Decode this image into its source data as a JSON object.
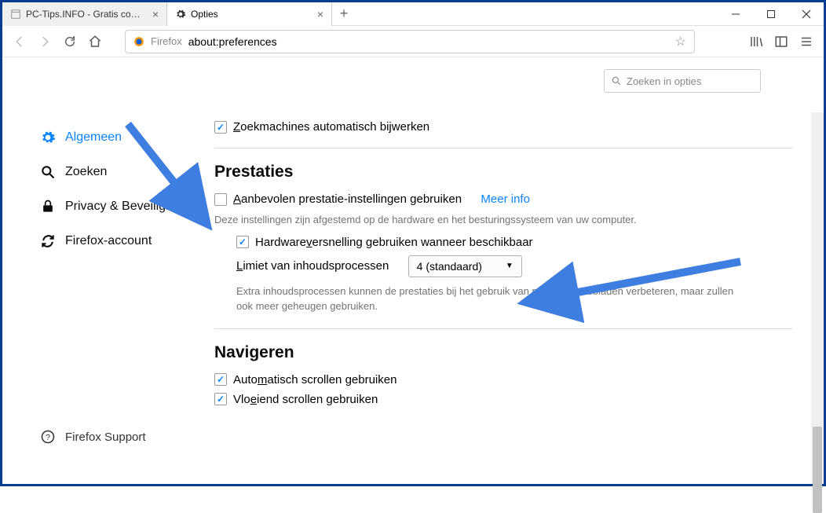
{
  "tabs": {
    "inactive": "PC-Tips.INFO - Gratis computer tips",
    "active": "Opties"
  },
  "urlbar": {
    "label": "Firefox",
    "url": "about:preferences"
  },
  "search": {
    "placeholder": "Zoeken in opties"
  },
  "sidebar": {
    "general": "Algemeen",
    "search": "Zoeken",
    "privacy": "Privacy & Beveiliging",
    "account": "Firefox-account",
    "support": "Firefox Support"
  },
  "updates": {
    "auto_search": "oekmachines automatisch bijwerken"
  },
  "perf": {
    "title": "Prestaties",
    "use_recommended": "anbevolen prestatie-instellingen gebruiken",
    "more_info": "Meer info",
    "desc1": "Deze instellingen zijn afgestemd op de hardware en het besturingssysteem van uw computer.",
    "hw_accel": "ersnelling gebruiken wanneer beschikbaar",
    "hw_accel_pre": "Hardware",
    "limit_pre": "L",
    "limit_label": "imiet van inhoudsprocessen",
    "limit_value": "4 (standaard)",
    "desc2": "Extra inhoudsprocessen kunnen de prestaties bij het gebruik van meerdere tabbladen verbeteren, maar zullen ook meer geheugen gebruiken."
  },
  "nav": {
    "title": "Navigeren",
    "auto_scroll": "atisch scrollen gebruiken",
    "auto_scroll_pre": "Auto",
    "smooth_scroll": "iend scrollen gebruiken",
    "smooth_scroll_pre": "Vlo"
  }
}
